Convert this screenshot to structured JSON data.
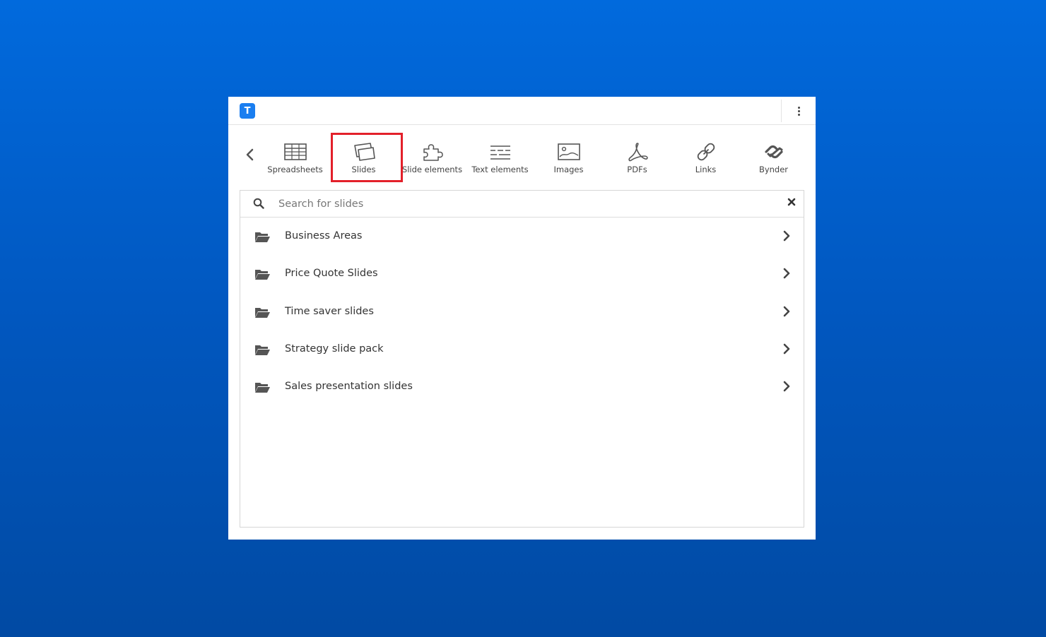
{
  "app": {
    "logo_letter": "T"
  },
  "tabs": [
    {
      "label": "Spreadsheets",
      "icon": "spreadsheet-icon"
    },
    {
      "label": "Slides",
      "icon": "slides-icon",
      "selected": true
    },
    {
      "label": "Slide elements",
      "icon": "puzzle-icon"
    },
    {
      "label": "Text elements",
      "icon": "text-lines-icon"
    },
    {
      "label": "Images",
      "icon": "image-icon"
    },
    {
      "label": "PDFs",
      "icon": "pdf-icon"
    },
    {
      "label": "Links",
      "icon": "link-icon"
    },
    {
      "label": "Bynder",
      "icon": "bynder-icon"
    }
  ],
  "search": {
    "placeholder": "Search for slides",
    "value": ""
  },
  "folders": [
    {
      "name": "Business Areas"
    },
    {
      "name": "Price Quote Slides"
    },
    {
      "name": "Time saver slides"
    },
    {
      "name": "Strategy slide pack"
    },
    {
      "name": "Sales presentation slides"
    }
  ],
  "colors": {
    "background_top": "#016add",
    "background_bottom": "#014aa3",
    "logo": "#1a7ef0",
    "selection_outline": "#e3202a"
  }
}
